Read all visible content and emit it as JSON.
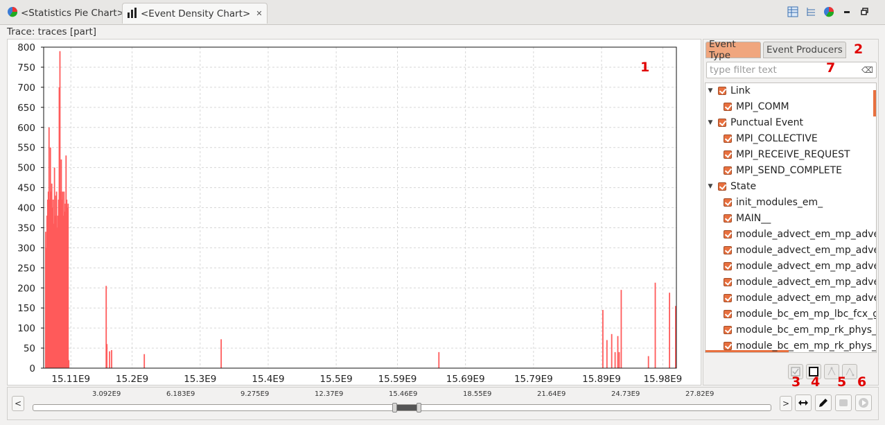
{
  "tabs": [
    {
      "label": "<Statistics Pie Chart>",
      "icon": "pie-chart-icon"
    },
    {
      "label": "<Event Density Chart>",
      "icon": "bar-chart-icon",
      "closable": true
    }
  ],
  "trace_label": "Trace: traces [part]",
  "annotations": [
    "1",
    "2",
    "3",
    "4",
    "5",
    "6",
    "7"
  ],
  "right_panel": {
    "tabs": [
      "Event Type",
      "Event Producers"
    ],
    "filter_placeholder": "type filter text",
    "tree": [
      {
        "label": "Link",
        "level": 0,
        "expanded": true
      },
      {
        "label": "MPI_COMM",
        "level": 1
      },
      {
        "label": "Punctual Event",
        "level": 0,
        "expanded": true
      },
      {
        "label": "MPI_COLLECTIVE",
        "level": 1
      },
      {
        "label": "MPI_RECEIVE_REQUEST",
        "level": 1
      },
      {
        "label": "MPI_SEND_COMPLETE",
        "level": 1
      },
      {
        "label": "State",
        "level": 0,
        "expanded": true
      },
      {
        "label": "init_modules_em_",
        "level": 1
      },
      {
        "label": "MAIN__",
        "level": 1
      },
      {
        "label": "module_advect_em_mp_adve",
        "level": 1
      },
      {
        "label": "module_advect_em_mp_adve",
        "level": 1
      },
      {
        "label": "module_advect_em_mp_adve",
        "level": 1
      },
      {
        "label": "module_advect_em_mp_adve",
        "level": 1
      },
      {
        "label": "module_advect_em_mp_adve",
        "level": 1
      },
      {
        "label": "module_bc_em_mp_lbc_fcx_g",
        "level": 1
      },
      {
        "label": "module_bc_em_mp_rk_phys_",
        "level": 1
      },
      {
        "label": "module_bc_em_mp_rk_phys_",
        "level": 1
      }
    ]
  },
  "nav": {
    "left_button": "<",
    "right_button": ">",
    "ruler_labels": [
      "3.092E9",
      "6.183E9",
      "9.275E9",
      "12.37E9",
      "15.46E9",
      "18.55E9",
      "21.64E9",
      "24.73E9",
      "27.82E9"
    ],
    "range_fraction": [
      0.49,
      0.522
    ]
  },
  "chart_data": {
    "type": "bar",
    "title": "",
    "xlabel": "",
    "ylabel": "",
    "ylim": [
      0,
      800
    ],
    "y_ticks": [
      0,
      50,
      100,
      150,
      200,
      250,
      300,
      350,
      400,
      450,
      500,
      550,
      600,
      650,
      700,
      750,
      800
    ],
    "x_ticks": [
      "15.11E9",
      "15.2E9",
      "15.3E9",
      "15.4E9",
      "15.5E9",
      "15.59E9",
      "15.69E9",
      "15.79E9",
      "15.89E9",
      "15.98E9"
    ],
    "x_tick_values": [
      15.11,
      15.2,
      15.3,
      15.4,
      15.5,
      15.59,
      15.69,
      15.79,
      15.89,
      15.98
    ],
    "xlim": [
      15.07,
      16.0
    ],
    "grid": true,
    "color": "#ff5a5a",
    "points": [
      [
        15.072,
        340
      ],
      [
        15.073,
        300
      ],
      [
        15.074,
        380
      ],
      [
        15.075,
        420
      ],
      [
        15.076,
        440
      ],
      [
        15.077,
        600
      ],
      [
        15.078,
        420
      ],
      [
        15.079,
        550
      ],
      [
        15.08,
        440
      ],
      [
        15.081,
        460
      ],
      [
        15.082,
        400
      ],
      [
        15.083,
        420
      ],
      [
        15.084,
        360
      ],
      [
        15.085,
        500
      ],
      [
        15.086,
        380
      ],
      [
        15.087,
        430
      ],
      [
        15.088,
        440
      ],
      [
        15.089,
        350
      ],
      [
        15.09,
        380
      ],
      [
        15.091,
        420
      ],
      [
        15.092,
        700
      ],
      [
        15.093,
        790
      ],
      [
        15.094,
        440
      ],
      [
        15.095,
        520
      ],
      [
        15.096,
        420
      ],
      [
        15.097,
        440
      ],
      [
        15.098,
        380
      ],
      [
        15.099,
        440
      ],
      [
        15.1,
        390
      ],
      [
        15.101,
        410
      ],
      [
        15.102,
        530
      ],
      [
        15.103,
        420
      ],
      [
        15.104,
        400
      ],
      [
        15.105,
        410
      ],
      [
        15.106,
        20
      ],
      [
        15.161,
        205
      ],
      [
        15.162,
        60
      ],
      [
        15.166,
        42
      ],
      [
        15.169,
        45
      ],
      [
        15.217,
        35
      ],
      [
        15.33,
        72
      ],
      [
        15.65,
        40
      ],
      [
        15.891,
        145
      ],
      [
        15.897,
        70
      ],
      [
        15.904,
        85
      ],
      [
        15.909,
        40
      ],
      [
        15.913,
        80
      ],
      [
        15.915,
        40
      ],
      [
        15.918,
        195
      ],
      [
        15.958,
        30
      ],
      [
        15.968,
        213
      ],
      [
        15.989,
        188
      ],
      [
        16.018,
        40
      ],
      [
        16.019,
        155
      ],
      [
        16.02,
        120
      ]
    ]
  }
}
